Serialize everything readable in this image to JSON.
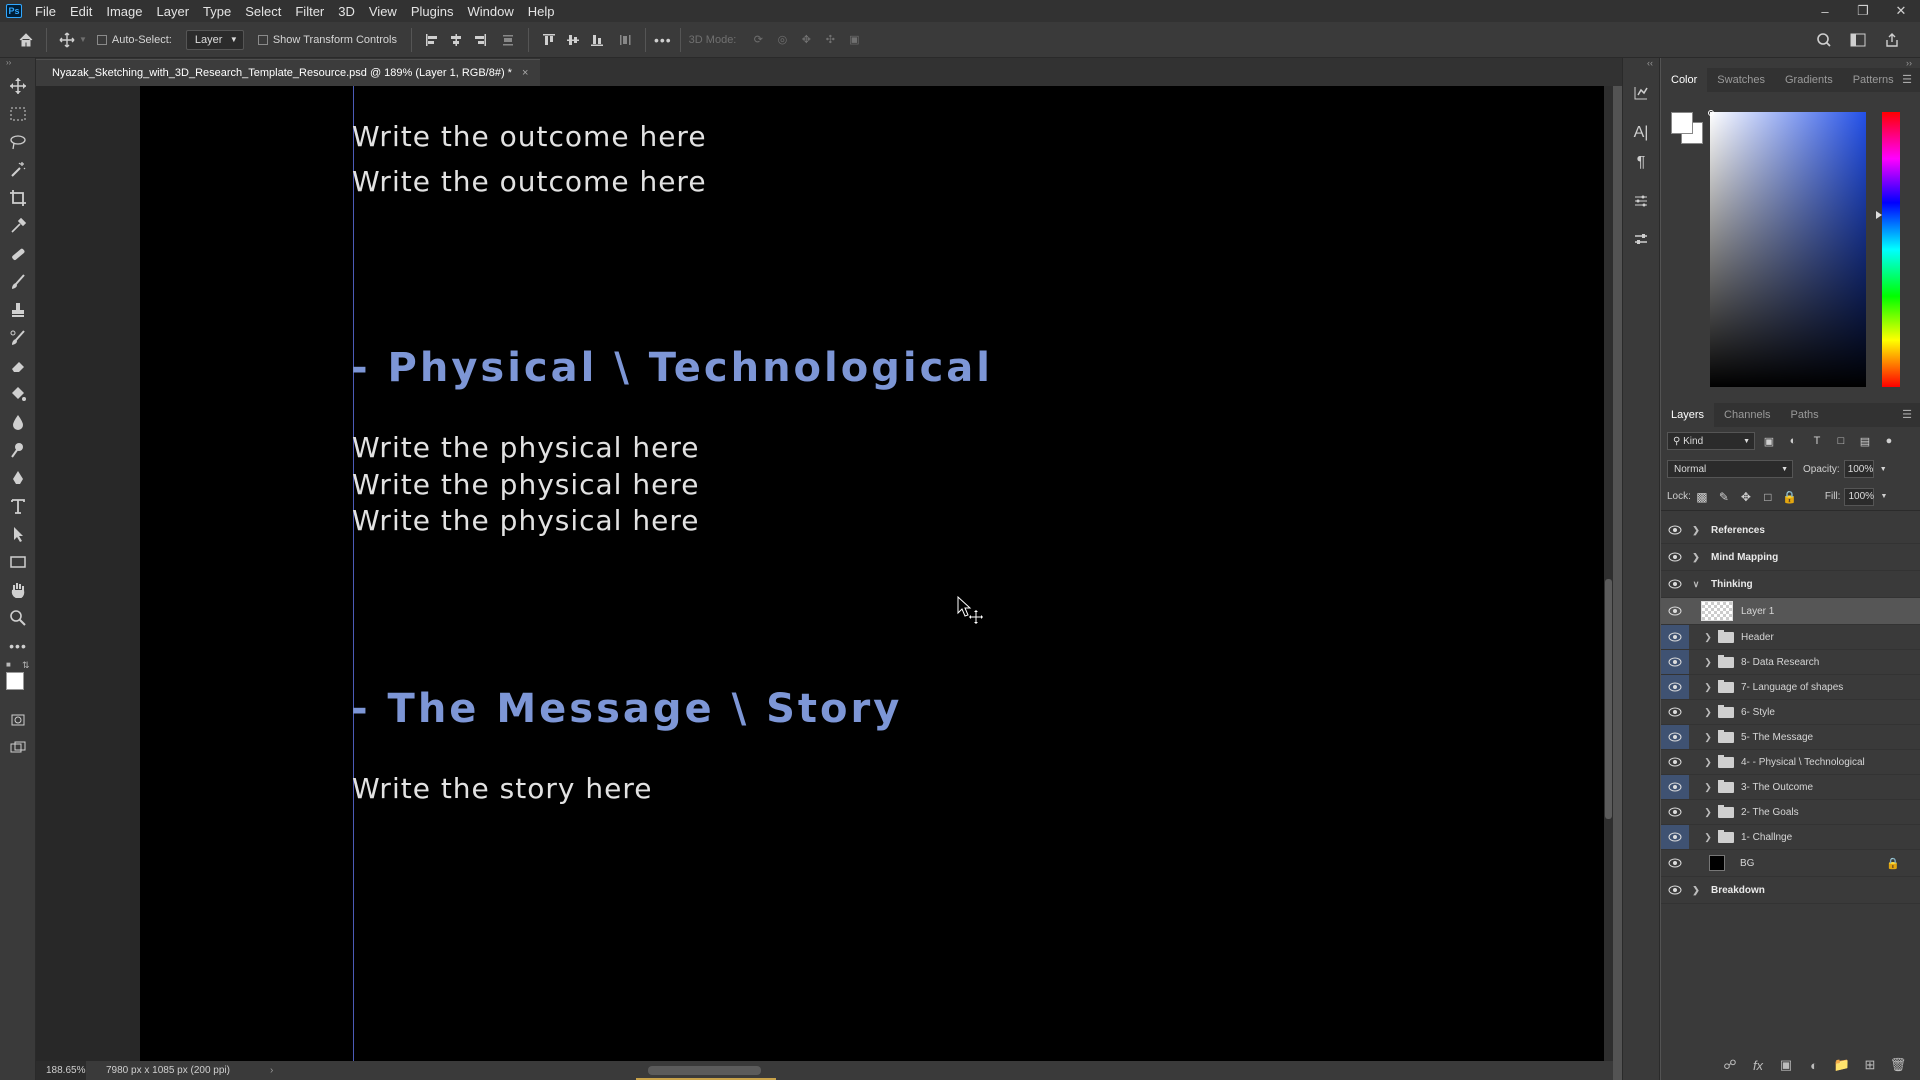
{
  "menubar": {
    "logo": "Ps",
    "items": [
      "File",
      "Edit",
      "Image",
      "Layer",
      "Type",
      "Select",
      "Filter",
      "3D",
      "View",
      "Plugins",
      "Window",
      "Help"
    ],
    "window_controls": {
      "minimize": "–",
      "restore": "❐",
      "close": "✕"
    }
  },
  "options": {
    "auto_select_label": "Auto-Select:",
    "auto_select_value": "Layer",
    "show_transform_label": "Show Transform Controls",
    "more": "•••",
    "mode_3d_label": "3D Mode:"
  },
  "document_tab": {
    "title": "Nyazak_Sketching_with_3D_Research_Template_Resource.psd @ 189% (Layer 1, RGB/8#) *",
    "close": "×"
  },
  "canvas": {
    "lines": [
      {
        "kind": "text",
        "text": "Write the outcome here"
      },
      {
        "kind": "text",
        "text": "Write the outcome here"
      },
      {
        "kind": "heading",
        "text": "- Physical \\ Technological"
      },
      {
        "kind": "text",
        "text": "Write the physical here"
      },
      {
        "kind": "text",
        "text": "Write the physical here"
      },
      {
        "kind": "text",
        "text": "Write the physical here"
      },
      {
        "kind": "heading",
        "text": "- The Message \\ Story"
      },
      {
        "kind": "text",
        "text": "Write the story here"
      }
    ],
    "heading_color": "#7d96d6"
  },
  "status": {
    "zoom": "188.65%",
    "doc_info": "7980 px x 1085 px (200 ppi)",
    "arrow": "›"
  },
  "color_panel": {
    "tabs": [
      "Color",
      "Swatches",
      "Gradients",
      "Patterns"
    ],
    "active_tab": "Color",
    "foreground": "#ffffff",
    "background": "#ffffff"
  },
  "layers_panel": {
    "tabs": [
      "Layers",
      "Channels",
      "Paths"
    ],
    "active_tab": "Layers",
    "filter_kind": "Kind",
    "blend_mode": "Normal",
    "opacity_label": "Opacity:",
    "opacity": "100%",
    "lock_label": "Lock:",
    "fill_label": "Fill:",
    "fill": "100%",
    "layers": [
      {
        "name": "References",
        "type": "group-top",
        "expanded": false,
        "eye_blue": false
      },
      {
        "name": "Mind Mapping",
        "type": "group-top",
        "expanded": false,
        "eye_blue": false
      },
      {
        "name": "Thinking",
        "type": "group-top",
        "expanded": true,
        "eye_blue": false
      },
      {
        "name": "Layer 1",
        "type": "pixel",
        "selected": true,
        "eye_blue": false
      },
      {
        "name": "Header",
        "type": "group",
        "eye_blue": true
      },
      {
        "name": "8- Data Research",
        "type": "group",
        "eye_blue": true
      },
      {
        "name": "7- Language of shapes",
        "type": "group",
        "eye_blue": true
      },
      {
        "name": "6- Style",
        "type": "group",
        "eye_blue": false
      },
      {
        "name": "5- The Message",
        "type": "group",
        "eye_blue": true
      },
      {
        "name": "4- - Physical \\ Technological",
        "type": "group",
        "eye_blue": false
      },
      {
        "name": "3- The Outcome",
        "type": "group",
        "eye_blue": true
      },
      {
        "name": "2- The Goals",
        "type": "group",
        "eye_blue": false
      },
      {
        "name": "1- Challnge",
        "type": "group",
        "eye_blue": true
      },
      {
        "name": "BG",
        "type": "background",
        "eye_blue": false,
        "locked": true
      },
      {
        "name": "Breakdown",
        "type": "group-top",
        "expanded": false,
        "eye_blue": false
      }
    ]
  }
}
